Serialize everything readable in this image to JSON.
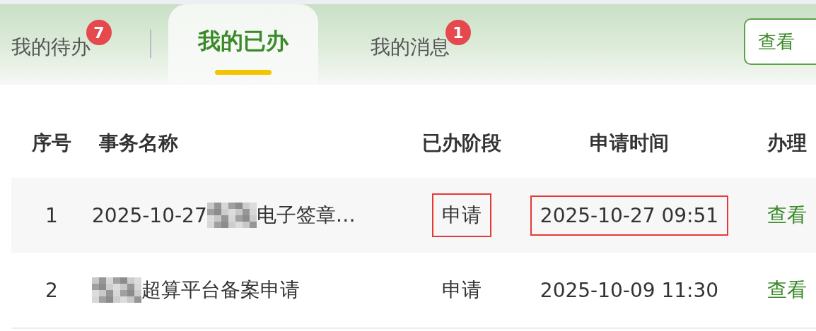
{
  "tabs": [
    {
      "label": "我的待办",
      "selected": false,
      "badge": "7"
    },
    {
      "label": "我的已办",
      "selected": true
    },
    {
      "label": "我的消息",
      "selected": false,
      "badge": "1"
    }
  ],
  "view_all_button": "查看",
  "table": {
    "columns": [
      "序号",
      "事务名称",
      "已办阶段",
      "申请时间",
      "办理"
    ],
    "rows": [
      {
        "index": "1",
        "name_before": "2025-10-27",
        "redacted": true,
        "name_after": "电子签章…",
        "stage": "申请",
        "time": "2025-10-27 09:51",
        "highlighted": true,
        "action": "查看"
      },
      {
        "index": "2",
        "name_before": "",
        "redacted": true,
        "name_after": "超算平台备案申请",
        "stage": "申请",
        "time": "2025-10-09 11:30",
        "highlighted": false,
        "action": "查看"
      }
    ]
  }
}
